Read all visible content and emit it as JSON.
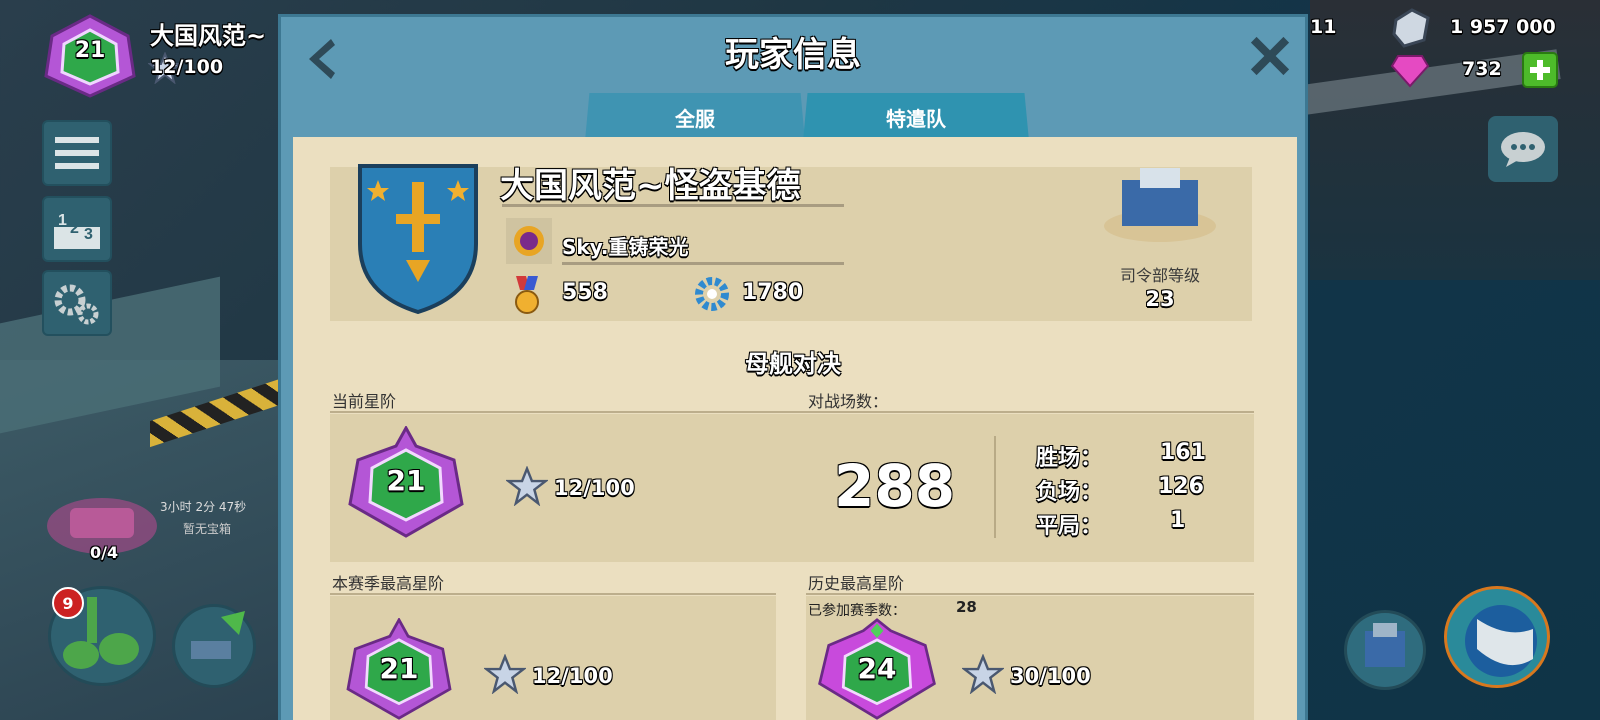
{
  "player": {
    "level": "21",
    "name": "大国风范~",
    "xp": "12/100"
  },
  "resources": {
    "partial_value": "11",
    "iron": "1 957 000",
    "gems": "732"
  },
  "hud_left": {
    "timer": "3小时 2分 47秒",
    "no_chest": "暂无宝箱",
    "chest_count": "0/4",
    "notif_count": "9"
  },
  "modal": {
    "title": "玩家信息",
    "tabs": [
      {
        "label": "全服"
      },
      {
        "label": "特遣队"
      }
    ],
    "profile": {
      "name": "大国风范~怪盗基德",
      "task_force": "Sky.重铸荣光",
      "medals": "558",
      "gear_count": "1780",
      "hq_label": "司令部等级",
      "hq_level": "23"
    },
    "section_title": "母舰对决",
    "current_rank": {
      "label": "当前星阶",
      "level": "21",
      "xp": "12/100"
    },
    "battles": {
      "label": "对战场数：",
      "total": "288",
      "wins_label": "胜场：",
      "wins": "161",
      "losses_label": "负场：",
      "losses": "126",
      "draws_label": "平局：",
      "draws": "1"
    },
    "season_best": {
      "label": "本赛季最高星阶",
      "level": "21",
      "xp": "12/100"
    },
    "history_best": {
      "label": "历史最高星阶",
      "seasons_label": "已参加赛季数：",
      "seasons": "28",
      "level": "24",
      "xp": "30/100"
    }
  },
  "colors": {
    "modal_frame": "#5d9ab5",
    "paper": "#ebdfc0",
    "card": "#ddd0ab",
    "rank_purple": "#b456d6",
    "rank_green": "#2fa84a"
  }
}
